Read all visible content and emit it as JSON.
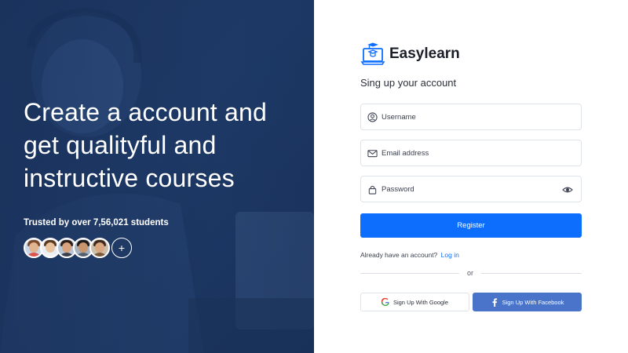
{
  "hero": {
    "title": "Create a account and get qualityful and instructive courses",
    "trusted": "Trusted by over 7,56,021 students",
    "more_label": "+"
  },
  "brand": {
    "name": "Easylearn",
    "logo_icon": "laptop-graduation-cap-icon"
  },
  "form": {
    "subtitle": "Sing up your account",
    "username_placeholder": "Username",
    "email_placeholder": "Email address",
    "password_placeholder": "Password",
    "register_label": "Register",
    "already_text": "Already have an account?",
    "login_link": "Log in",
    "divider_text": "or",
    "google_label": "Sign Up With Google",
    "facebook_label": "Sign Up With Facebook"
  },
  "colors": {
    "accent": "#0d6efd",
    "hero_bg": "#1f3a66",
    "facebook": "#4a74c9"
  }
}
